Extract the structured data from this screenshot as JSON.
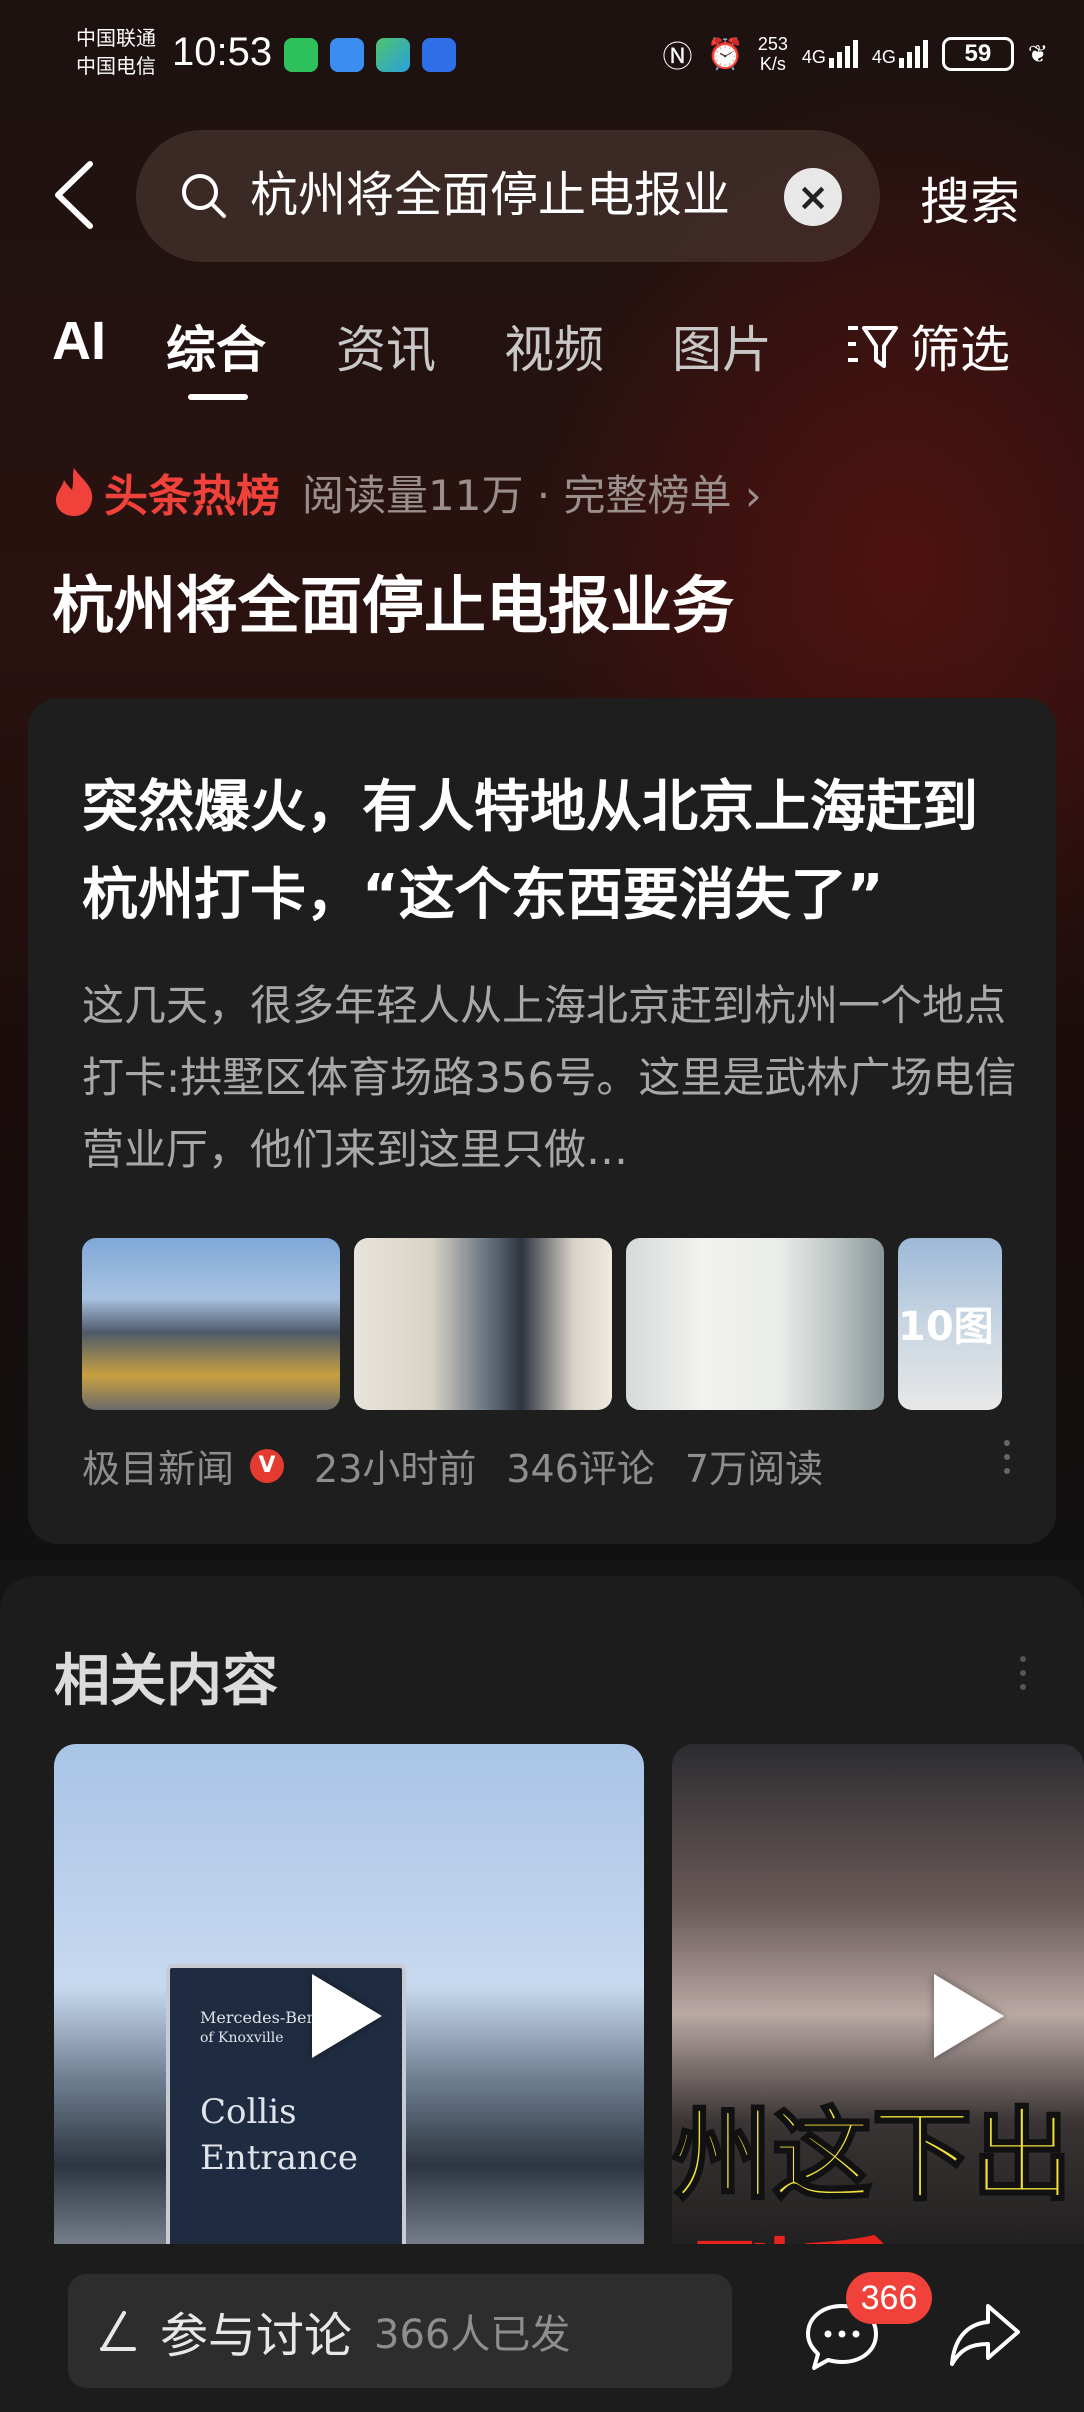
{
  "status_bar": {
    "carrier_1": "中国联通",
    "carrier_2": "中国电信",
    "time": "10:53",
    "speed_value": "253",
    "speed_unit": "K/s",
    "net_1": "4G",
    "net_2": "4G",
    "battery": "59",
    "app_icons": [
      "wechat-icon",
      "meitu-icon",
      "app-icon",
      "baidu-icon"
    ],
    "right_icons": [
      "nfc-icon",
      "alarm-icon",
      "signal-icon",
      "battery-icon",
      "leaf-icon"
    ]
  },
  "header": {
    "back_icon": "back-arrow-icon",
    "search_query": "杭州将全面停止电报业",
    "search_button": "搜索"
  },
  "tabs": [
    {
      "label": "AI"
    },
    {
      "label": "综合",
      "active": true
    },
    {
      "label": "资讯"
    },
    {
      "label": "视频"
    },
    {
      "label": "图片"
    },
    {
      "label": "筛选"
    }
  ],
  "hot": {
    "label": "头条热榜",
    "meta": "阅读量11万 · 完整榜单 ›",
    "title": "杭州将全面停止电报业务"
  },
  "article": {
    "title": "突然爆火，有人特地从北京上海赶到杭州打卡，“这个东西要消失了”",
    "description": "这几天，很多年轻人从上海北京赶到杭州一个地点打卡:拱墅区体育场路356号。这里是武林广场电信营业厅，他们来到这里只做…",
    "image_count": "10图",
    "source": "极目新闻",
    "verified_badge": "V",
    "time_ago": "23小时前",
    "comments": "346评论",
    "reads": "7万阅读"
  },
  "related": {
    "title": "相关内容",
    "video_1_sign": [
      "Mercedes-Benz",
      "of Knoxville",
      "Collis",
      "Entrance"
    ],
    "video_2_caption_top": "州这下出",
    "video_2_caption_bottom": "到后"
  },
  "bottom": {
    "discuss_label": "参与讨论",
    "discuss_count": "366人已发",
    "comment_badge": "366"
  },
  "colors": {
    "accent_red": "#f0413a",
    "background": "#141414",
    "card": "#1e1e1f"
  }
}
